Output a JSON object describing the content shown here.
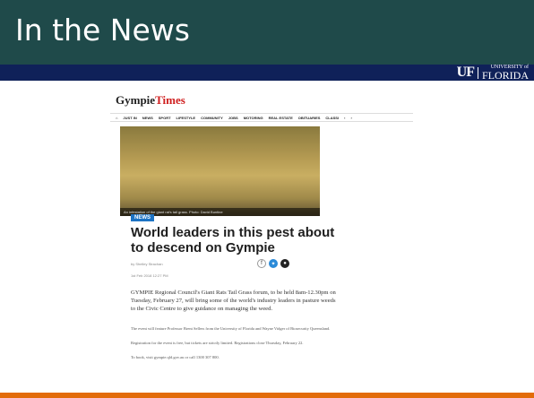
{
  "slide": {
    "title": "In the News"
  },
  "logo": {
    "mark": "UF",
    "small_text": "UNIVERSITY of",
    "big_text": "FLORIDA"
  },
  "article": {
    "masthead": {
      "part1": "Gympie",
      "part2": "Times"
    },
    "nav_items": [
      "JUST IN",
      "NEWS",
      "SPORT",
      "LIFESTYLE",
      "COMMUNITY",
      "JOBS",
      "MOTORING",
      "REAL ESTATE",
      "OBITUARIES",
      "CLASSI"
    ],
    "photo_caption": "An infestation of the giant rat's tail grass. Photo: David Buntine",
    "badge": "NEWS",
    "headline": "World leaders in this pest about to descend on Gympie",
    "byline": "by Shelley Strachan",
    "date": "1st Feb 2018 12:27 PM",
    "lead": "GYMPIE Regional Council's Giant Rats Tail Grass forum, to be held 8am-12.30pm on Tuesday, February 27, will bring some of the world's industry leaders in pasture weeds to the Civic Centre to give guidance on managing the weed.",
    "para2": "The event will feature Professor Brent Sellers from the University of Florida and Wayne Vidger of Biosecurity Queensland.",
    "para3": "Registration for the event is free, but tickets are strictly limited. Registrations close Thursday, February 22.",
    "para4": "To book, visit gympie.qld.gov.au or call 1300 307 800."
  },
  "colors": {
    "title_bar": "#1f4a4a",
    "navy_band": "#0f2159",
    "accent_line": "#e36c0a",
    "badge": "#1d73c4"
  }
}
